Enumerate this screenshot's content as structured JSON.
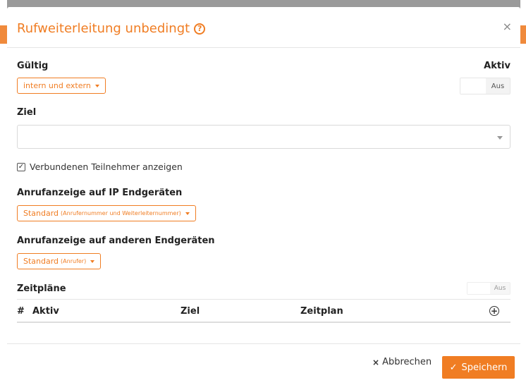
{
  "dialog": {
    "title": "Rufweiterleitung unbedingt",
    "help_icon": "question-circle-icon",
    "close_glyph": "×"
  },
  "gueltig": {
    "label": "Gültig",
    "value": "intern und extern"
  },
  "aktiv": {
    "label": "Aktiv",
    "toggle_state": "Aus"
  },
  "ziel": {
    "label": "Ziel",
    "value": ""
  },
  "checkbox": {
    "checked": true,
    "check_glyph": "✓",
    "label": "Verbundenen Teilnehmer anzeigen"
  },
  "ip_display": {
    "label": "Anrufanzeige auf IP Endgeräten",
    "value": "Standard",
    "detail": "(Anrufernummer und Weiterleiternummer)"
  },
  "other_display": {
    "label": "Anrufanzeige auf anderen Endgeräten",
    "value": "Standard",
    "detail": "(Anrufer)"
  },
  "schedules": {
    "label": "Zeitpläne",
    "toggle_state": "Aus",
    "columns": [
      "#",
      "Aktiv",
      "Ziel",
      "Zeitplan"
    ],
    "add_glyph": "+",
    "rows": []
  },
  "footer": {
    "cancel_glyph": "×",
    "cancel_label": "Abbrechen",
    "save_glyph": "✓",
    "save_label": "Speichern"
  },
  "colors": {
    "accent": "#f07d23",
    "backdrop": "#9a9a9a"
  }
}
